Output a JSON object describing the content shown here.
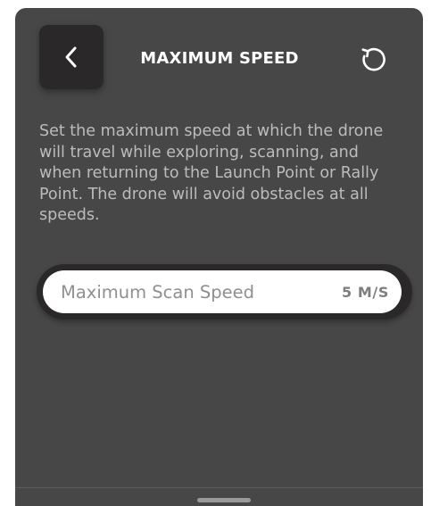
{
  "header": {
    "title": "MAXIMUM SPEED",
    "back_icon": "chevron-left-icon",
    "reset_icon": "reset-icon"
  },
  "description": "Set the maximum speed at which the drone will travel while exploring, scanning, and when returning to the Launch Point or Rally Point. The drone will avoid obstacles at all speeds.",
  "setting": {
    "label": "Maximum Scan Speed",
    "value": "5 M/S"
  },
  "colors": {
    "panel_background": "#474747",
    "button_background": "#2a2828",
    "title_text": "#ffffff",
    "description_text": "#bcbcbc",
    "pill_background": "#ffffff"
  }
}
